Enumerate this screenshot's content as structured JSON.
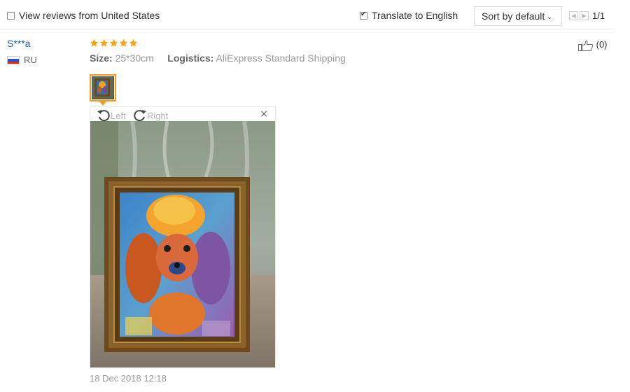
{
  "filters": {
    "view_reviews_label": "View reviews from United States",
    "view_reviews_checked": false,
    "translate_label": "Translate to English",
    "translate_checked": true,
    "sort_label": "Sort by default",
    "pagination": "1/1"
  },
  "review": {
    "user": "S***a",
    "country": "RU",
    "stars": 5,
    "size_label": "Size:",
    "size_value": "25*30cm",
    "logistics_label": "Logistics:",
    "logistics_value": "AliExpress Standard Shipping",
    "helpful_count": "(0)",
    "date": "18 Dec 2018 12:18"
  },
  "viewer": {
    "rotate_left": "Left",
    "rotate_right": "Right",
    "close": "×"
  },
  "colors": {
    "star": "#f7a21b",
    "link": "#1a5fb4",
    "thumb_border": "#f39c1f"
  }
}
